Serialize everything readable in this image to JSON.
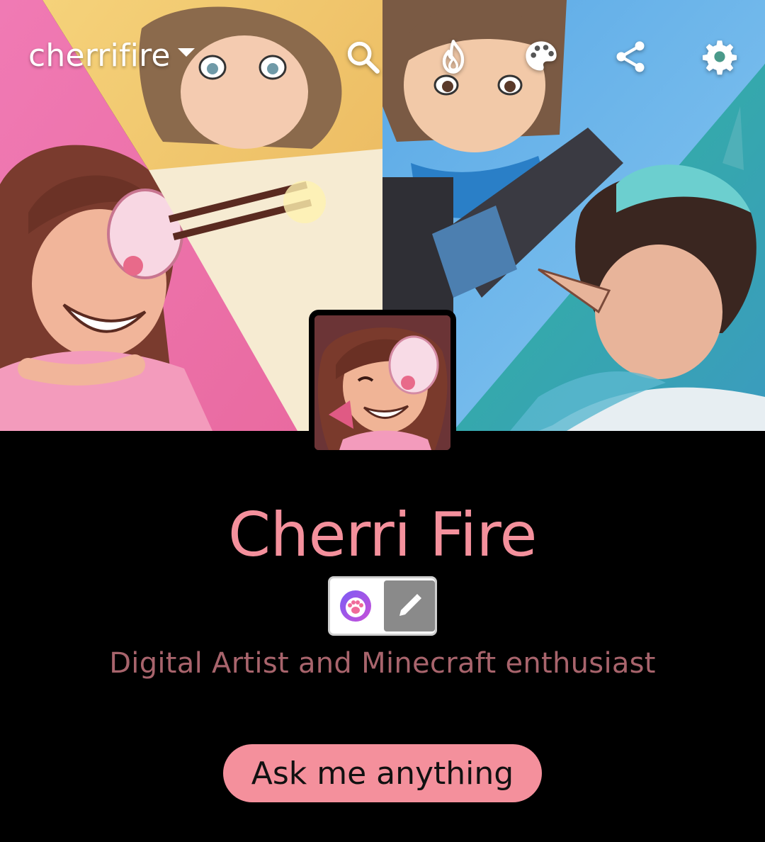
{
  "topbar": {
    "blog_name": "cherrifire",
    "icons": [
      "search-icon",
      "fire-icon",
      "palette-icon",
      "share-icon",
      "gear-icon"
    ]
  },
  "profile": {
    "display_name": "Cherri Fire",
    "bio": "Digital Artist and Minecraft enthusiast",
    "ask_button_label": "Ask me anything",
    "badge_icon": "paw-badge-icon",
    "edit_icon": "pencil-icon"
  },
  "colors": {
    "accent": "#f4909c",
    "bio_text": "#a8646c",
    "background": "#000000"
  }
}
